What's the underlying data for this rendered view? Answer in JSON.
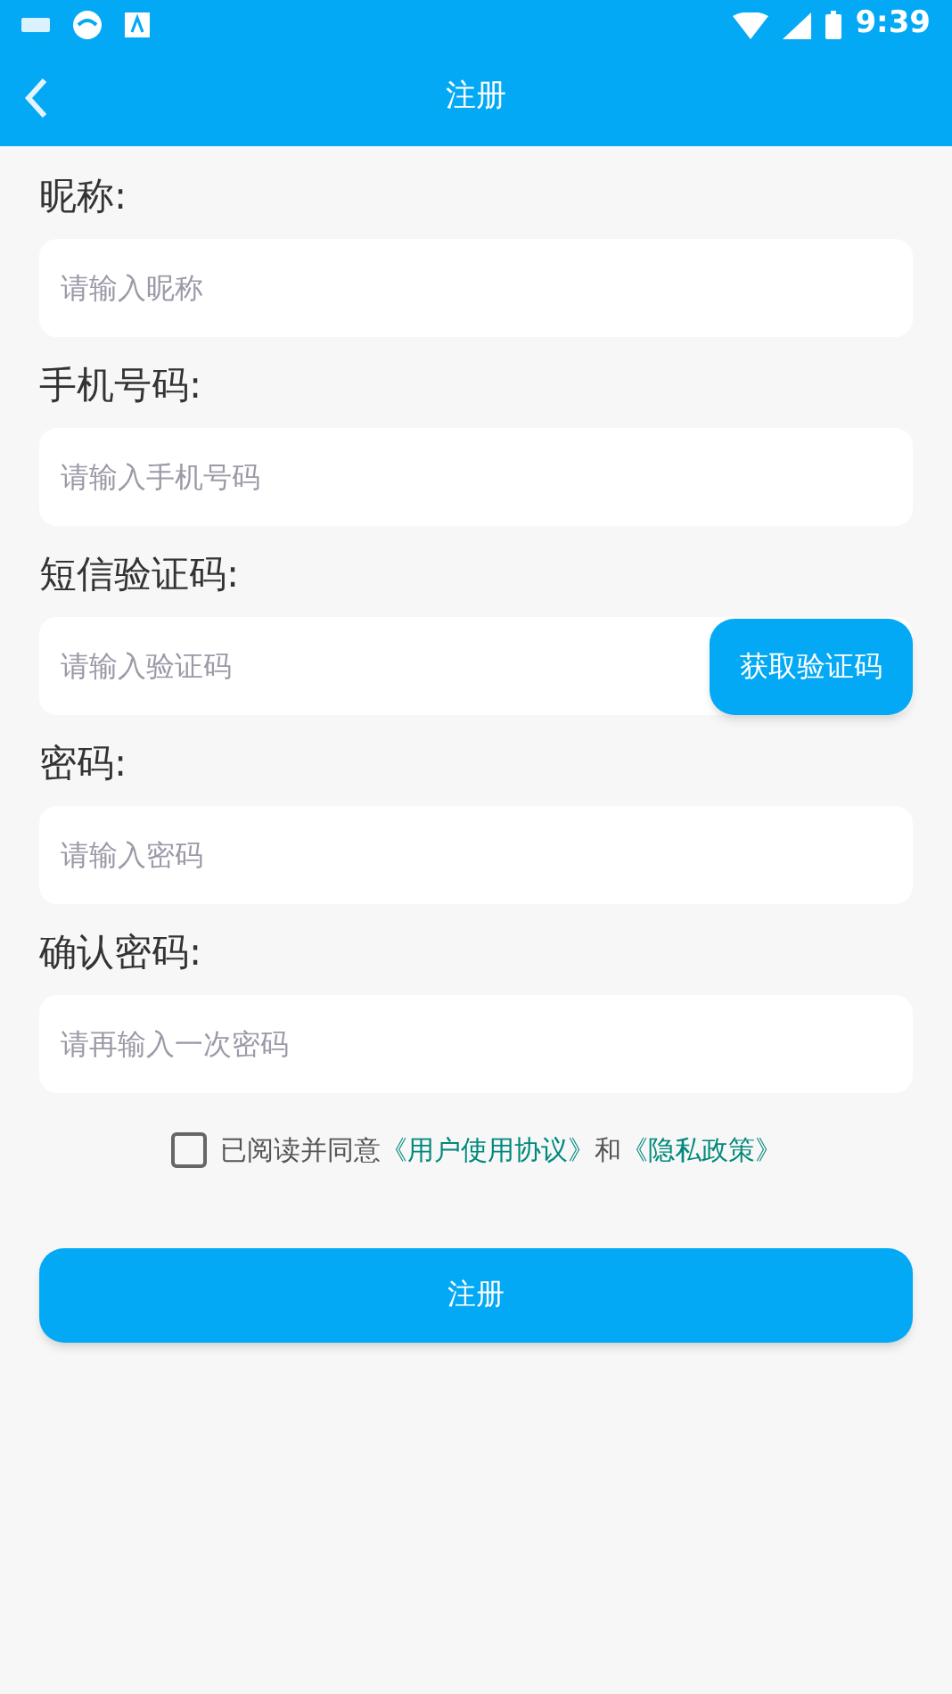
{
  "status_bar": {
    "time": "9:39"
  },
  "header": {
    "title": "注册"
  },
  "fields": [
    {
      "kind": "text",
      "label": "昵称:",
      "placeholder": "请输入昵称"
    },
    {
      "kind": "text",
      "label": "手机号码:",
      "placeholder": "请输入手机号码"
    },
    {
      "kind": "code",
      "label": "短信验证码:",
      "placeholder": "请输入验证码",
      "button": "获取验证码"
    },
    {
      "kind": "text",
      "label": "密码:",
      "placeholder": "请输入密码"
    },
    {
      "kind": "text",
      "label": "确认密码:",
      "placeholder": "请再输入一次密码"
    }
  ],
  "agreement": {
    "checked": false,
    "text": "已阅读并同意",
    "link_1": "《用户使用协议》",
    "joiner": "和",
    "link_2": "《隐私政策》"
  },
  "submit": "注册"
}
